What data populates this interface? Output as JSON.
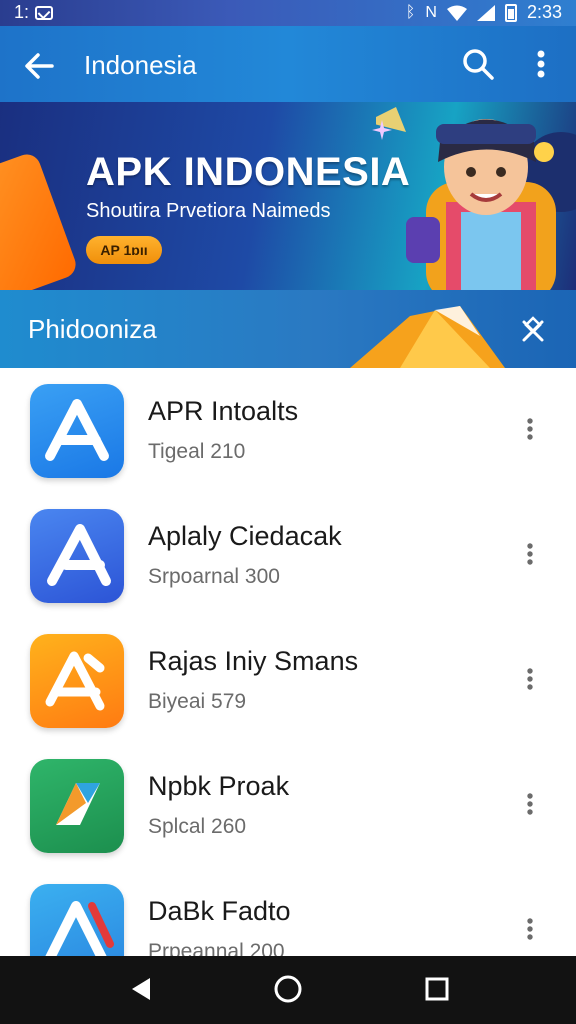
{
  "status_bar": {
    "time_left": "1:",
    "time_right": "2:33",
    "network_letter": "N"
  },
  "app_bar": {
    "title": "Indonesia",
    "back_icon": "arrow-left-icon",
    "search_icon": "search-icon",
    "more_icon": "more-vertical-icon"
  },
  "banner": {
    "heading": "APK INDONESIA",
    "subtitle": "Shoutira Prvetiora Naimeds",
    "pill_label": "AP 1ɒıı"
  },
  "section": {
    "label": "Phidooniza",
    "pin_icon": "pin-off-icon"
  },
  "apps": [
    {
      "name": "APR Intoalts",
      "meta": "Tigeal 210",
      "colors": [
        "#3aa0f4",
        "#1a78e6"
      ],
      "glyph": "A-white"
    },
    {
      "name": "Aplaly Ciedacak",
      "meta": "Srpoarnal  300",
      "colors": [
        "#4a86f0",
        "#2c54d6"
      ],
      "glyph": "A-white"
    },
    {
      "name": "Rajas Iniy Smans",
      "meta": "Biyeai 579",
      "colors": [
        "#ffb21c",
        "#ff7b12"
      ],
      "glyph": "A-white"
    },
    {
      "name": "Npbk Proak",
      "meta": "Splcal 260",
      "colors": [
        "#2fb56a",
        "#1c8f4e"
      ],
      "glyph": "play"
    },
    {
      "name": "DaBk Fadto",
      "meta": "Prpeannal 200",
      "colors": [
        "#3bb0f0",
        "#2a86e0"
      ],
      "glyph": "A-red"
    }
  ],
  "nav_bar": {
    "back_icon": "triangle-back-icon",
    "home_icon": "circle-home-icon",
    "recents_icon": "square-recents-icon"
  },
  "colors": {
    "app_bar": "#2288d8",
    "section": "#2a79c2",
    "accent_orange": "#f6a21c"
  }
}
